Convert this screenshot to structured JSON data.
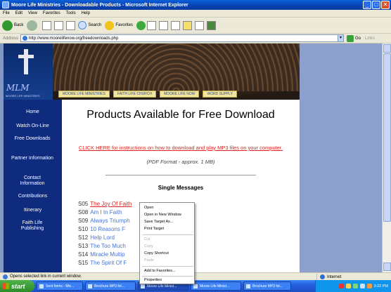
{
  "window": {
    "title": "Moore Life Ministries - Downloadable Products - Microsoft Internet Explorer",
    "buttons": [
      "_",
      "□",
      "✕"
    ]
  },
  "menu": [
    "File",
    "Edit",
    "View",
    "Favorites",
    "Tools",
    "Help"
  ],
  "toolbar": {
    "back_label": "Back",
    "search_label": "Search",
    "favorites_label": "Favorites"
  },
  "addressbar": {
    "label": "Address",
    "url": "http://www.moorelifenow.org/freedownloads.php",
    "go_label": "Go",
    "links_label": "Links"
  },
  "banner": {
    "logo_text": "MLM",
    "logo_sub": "MOORE LIFE MINISTRIES",
    "tabs": [
      "MOORE LIFE MINISTRIES",
      "FAITH LIFE CHURCH",
      "MOORE LIFE NOW",
      "WORD SUPPLY"
    ]
  },
  "sidebar": {
    "items": [
      "Home",
      "Watch On-Line",
      "Free Downloads",
      "Partner Information",
      "Contact Information",
      "Contributions",
      "Itinerary",
      "Faith Life Publishing"
    ]
  },
  "content": {
    "title": "Products Available for Free Download",
    "help_link": "CLICK HERE for instructions on how to download and play MP3 files on your computer.",
    "pdf_note": "(PDF Format - approx. 1 MB)",
    "section_title": "Single Messages",
    "messages": [
      {
        "code": "S05",
        "title": "The Joy Of Faith"
      },
      {
        "code": "S08",
        "title": "Am I In Faith"
      },
      {
        "code": "S09",
        "title": "Always Triumph"
      },
      {
        "code": "S10",
        "title": "10 Reasons F"
      },
      {
        "code": "S12",
        "title": "Help Lord"
      },
      {
        "code": "S13",
        "title": "The Too Much"
      },
      {
        "code": "S14",
        "title": "Miracle Multip"
      },
      {
        "code": "S15",
        "title": "The Spirit Of F"
      }
    ]
  },
  "context_menu": {
    "items": [
      {
        "label": "Open",
        "enabled": true
      },
      {
        "label": "Open in New Window",
        "enabled": true
      },
      {
        "label": "Save Target As...",
        "enabled": true
      },
      {
        "label": "Print Target",
        "enabled": true
      },
      {
        "label": "Cut",
        "enabled": false
      },
      {
        "label": "Copy",
        "enabled": false
      },
      {
        "label": "Copy Shortcut",
        "enabled": true
      },
      {
        "label": "Paste",
        "enabled": false
      },
      {
        "label": "Add to Favorites...",
        "enabled": true
      },
      {
        "label": "Properties",
        "enabled": true
      }
    ]
  },
  "statusbar": {
    "text": "Opens selected link in current window.",
    "zone": "Internet"
  },
  "taskbar": {
    "start_label": "start",
    "tasks": [
      "Sent Items - Mic...",
      "Brochure MP3 fol...",
      "Moore Life Minist...",
      "Moore Life Minist...",
      "Brochure MP3 fol..."
    ],
    "clock": "3:22 PM"
  }
}
